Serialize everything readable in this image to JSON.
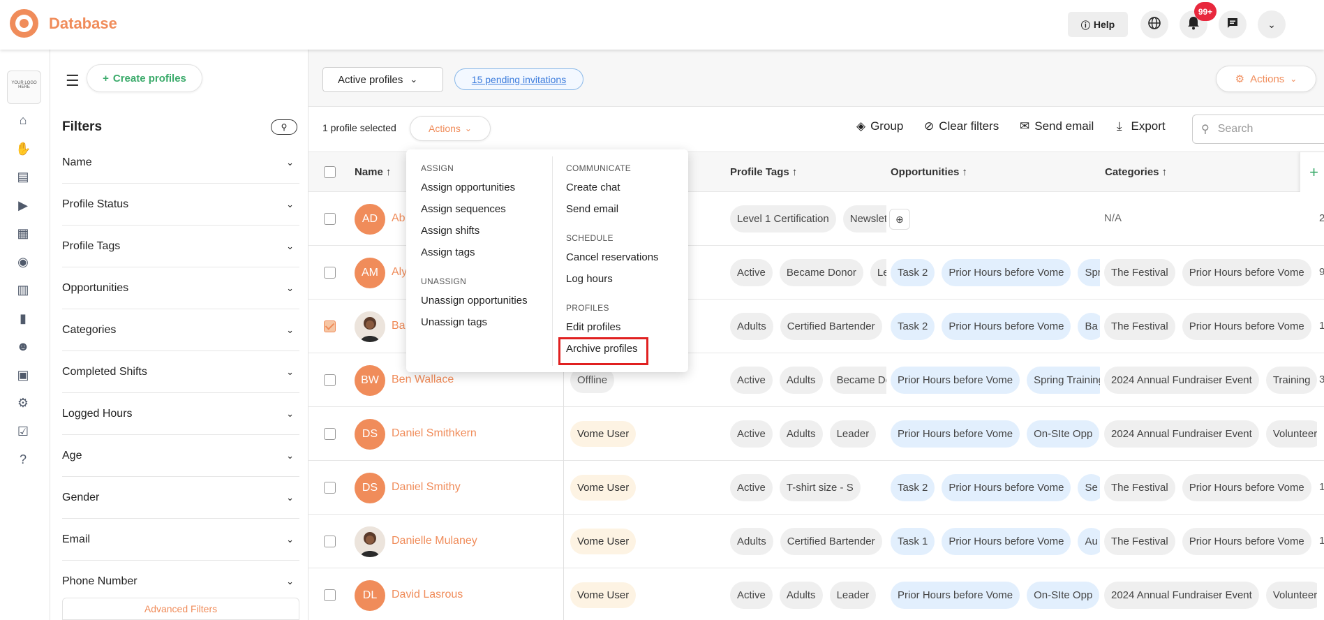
{
  "app": {
    "title": "Database",
    "help_label": "Help",
    "notification_count": "99+"
  },
  "rail": {
    "top_label": "YOUR LOGO HERE"
  },
  "filters": {
    "create_button": "Create profiles",
    "title": "Filters",
    "items": [
      "Name",
      "Profile Status",
      "Profile Tags",
      "Opportunities",
      "Categories",
      "Completed Shifts",
      "Logged Hours",
      "Age",
      "Gender",
      "Email",
      "Phone Number"
    ],
    "advanced": "Advanced Filters"
  },
  "toolbar": {
    "status_select": "Active profiles",
    "pending_invitations": "15 pending invitations",
    "actions_label": "Actions",
    "selected_count": "1 profile selected",
    "group": "Group",
    "clear_filters": "Clear filters",
    "send_email": "Send email",
    "export": "Export",
    "search_placeholder": "Search"
  },
  "table": {
    "headers": [
      "Name",
      "Profile Tags",
      "Opportunities",
      "Categories"
    ],
    "rows": [
      {
        "initials": "AD",
        "name": "Ab",
        "status": "",
        "checked": false,
        "tags": [
          "Level 1 Certification",
          "Newsletter"
        ],
        "opps": [],
        "cats": [],
        "na": "N/A",
        "last": "2"
      },
      {
        "initials": "AM",
        "name": "Aly",
        "status": "",
        "checked": false,
        "tags": [
          "Active",
          "Became Donor",
          "Leader"
        ],
        "opps": [
          "Task 2",
          "Prior Hours before Vome",
          "Spring"
        ],
        "cats": [
          "The Festival",
          "Prior Hours before Vome"
        ],
        "last": "9"
      },
      {
        "initials": "",
        "name": "Ba",
        "status": "",
        "checked": true,
        "tags": [
          "Adults",
          "Certified Bartender"
        ],
        "opps": [
          "Task 2",
          "Prior Hours before Vome",
          "Ba"
        ],
        "cats": [
          "The Festival",
          "Prior Hours before Vome"
        ],
        "last": "1"
      },
      {
        "initials": "BW",
        "name": "Ben Wallace",
        "status": "Offline",
        "checked": false,
        "tags": [
          "Active",
          "Adults",
          "Became Donor"
        ],
        "opps": [
          "Prior Hours before Vome",
          "Spring Training"
        ],
        "cats": [
          "2024 Annual Fundraiser Event",
          "Training"
        ],
        "last": "3"
      },
      {
        "initials": "DS",
        "name": "Daniel Smithkern",
        "status": "Vome User",
        "checked": false,
        "tags": [
          "Active",
          "Adults",
          "Leader"
        ],
        "opps": [
          "Prior Hours before Vome",
          "On-SIte Opp"
        ],
        "cats": [
          "2024 Annual Fundraiser Event",
          "Volunteer"
        ],
        "last": ""
      },
      {
        "initials": "DS",
        "name": "Daniel Smithy",
        "status": "Vome User",
        "checked": false,
        "tags": [
          "Active",
          "T-shirt size - S"
        ],
        "opps": [
          "Task 2",
          "Prior Hours before Vome",
          "Se"
        ],
        "cats": [
          "The Festival",
          "Prior Hours before Vome"
        ],
        "last": "1"
      },
      {
        "initials": "",
        "name": "Danielle Mulaney",
        "status": "Vome User",
        "checked": false,
        "tags": [
          "Adults",
          "Certified Bartender"
        ],
        "opps": [
          "Task 1",
          "Prior Hours before Vome",
          "Au"
        ],
        "cats": [
          "The Festival",
          "Prior Hours before Vome"
        ],
        "last": "1"
      },
      {
        "initials": "DL",
        "name": "David Lasrous",
        "status": "Vome User",
        "checked": false,
        "tags": [
          "Active",
          "Adults",
          "Leader"
        ],
        "opps": [
          "Prior Hours before Vome",
          "On-SIte Opp"
        ],
        "cats": [
          "2024 Annual Fundraiser Event",
          "Volunteer"
        ],
        "last": ""
      }
    ]
  },
  "menu": {
    "assign_head": "ASSIGN",
    "assign": [
      "Assign opportunities",
      "Assign sequences",
      "Assign shifts",
      "Assign tags"
    ],
    "unassign_head": "UNASSIGN",
    "unassign": [
      "Unassign opportunities",
      "Unassign tags"
    ],
    "communicate_head": "COMMUNICATE",
    "communicate": [
      "Create chat",
      "Send email"
    ],
    "schedule_head": "SCHEDULE",
    "schedule": [
      "Cancel reservations",
      "Log hours"
    ],
    "profiles_head": "PROFILES",
    "profiles": [
      "Edit profiles",
      "Archive profiles"
    ]
  },
  "colors": {
    "accent": "#f08c5a",
    "green": "#3aaa6a",
    "link": "#3d7ddd",
    "highlight": "#e02020"
  }
}
